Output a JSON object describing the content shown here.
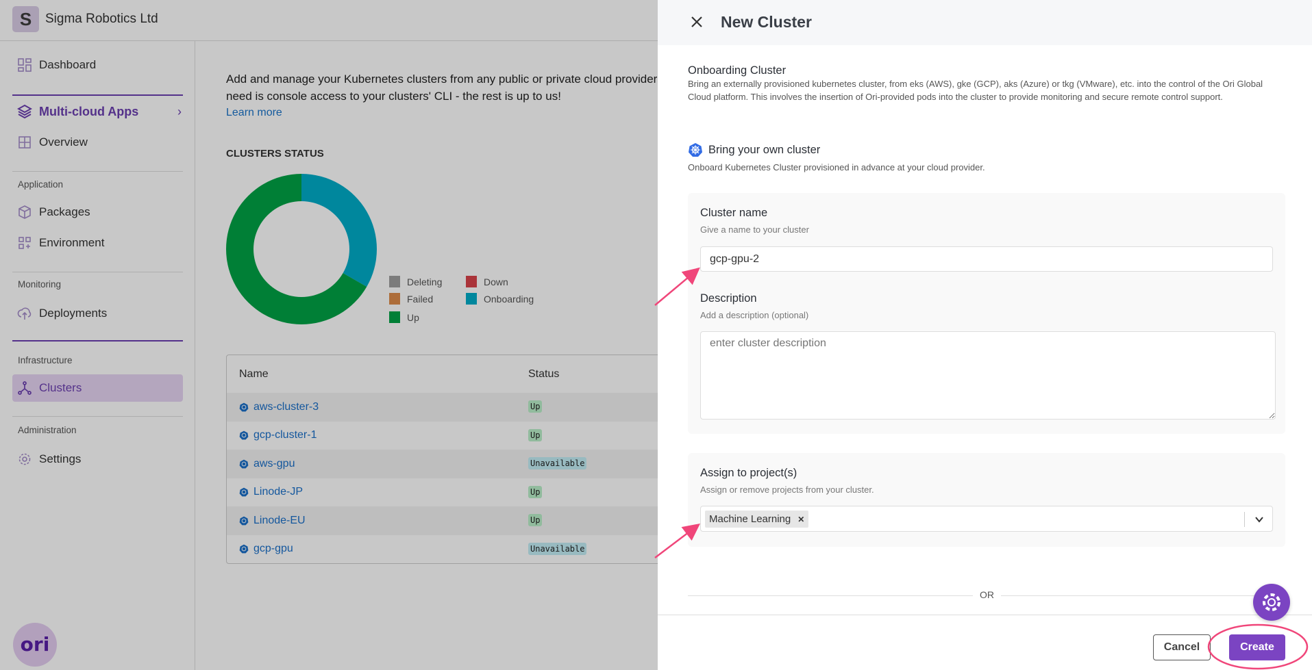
{
  "org": {
    "initial": "S",
    "name": "Sigma Robotics Ltd"
  },
  "sidebar": {
    "dashboard": "Dashboard",
    "multicloud": "Multi-cloud Apps",
    "overview": "Overview",
    "sec_application": "Application",
    "packages": "Packages",
    "environment": "Environment",
    "sec_monitoring": "Monitoring",
    "deployments": "Deployments",
    "sec_infrastructure": "Infrastructure",
    "clusters": "Clusters",
    "sec_administration": "Administration",
    "settings": "Settings",
    "logo": "ori"
  },
  "main": {
    "intro_line1": "Add and manage your Kubernetes clusters from any public or private cloud providers - i",
    "intro_line2": "need is console access to your clusters' CLI - the rest is up to us!",
    "learn_more": "Learn more",
    "status_title": "CLUSTERS STATUS",
    "table": {
      "col_name": "Name",
      "col_status": "Status",
      "rows": [
        {
          "name": "aws-cluster-3",
          "status": "Up"
        },
        {
          "name": "gcp-cluster-1",
          "status": "Up"
        },
        {
          "name": "aws-gpu",
          "status": "Unavailable"
        },
        {
          "name": "Linode-JP",
          "status": "Up"
        },
        {
          "name": "Linode-EU",
          "status": "Up"
        },
        {
          "name": "gcp-gpu",
          "status": "Unavailable"
        }
      ]
    }
  },
  "chart_data": {
    "type": "pie",
    "title": "CLUSTERS STATUS",
    "donut": true,
    "legend_position": "bottom-right",
    "categories": [
      "Deleting",
      "Down",
      "Failed",
      "Onboarding",
      "Up"
    ],
    "values": [
      0,
      0,
      0,
      2,
      4
    ],
    "colors": {
      "Deleting": "#9e9e9e",
      "Down": "#d9434b",
      "Failed": "#dd8c4a",
      "Onboarding": "#00adc8",
      "Up": "#00a346"
    }
  },
  "panel": {
    "title": "New Cluster",
    "onboarding_title": "Onboarding Cluster",
    "onboarding_desc": "Bring an externally provisioned kubernetes cluster, from eks (AWS), gke (GCP), aks (Azure) or tkg (VMware), etc. into the control of the Ori Global Cloud platform. This involves the insertion of Ori-provided pods into the cluster to provide monitoring and secure remote control support.",
    "byo_title": "Bring your own cluster",
    "byo_desc": "Onboard Kubernetes Cluster provisioned in advance at your cloud provider.",
    "name_label": "Cluster name",
    "name_help": "Give a name to your cluster",
    "name_value": "gcp-gpu-2",
    "desc_label": "Description",
    "desc_help": "Add a description (optional)",
    "desc_placeholder": "enter cluster description",
    "proj_label": "Assign to project(s)",
    "proj_help": "Assign or remove projects from your cluster.",
    "proj_tags": [
      "Machine Learning"
    ],
    "or": "OR",
    "cancel": "Cancel",
    "create": "Create"
  },
  "colors": {
    "accent": "#7b44c2",
    "link": "#1a73c9",
    "annotation": "#f0467a"
  }
}
